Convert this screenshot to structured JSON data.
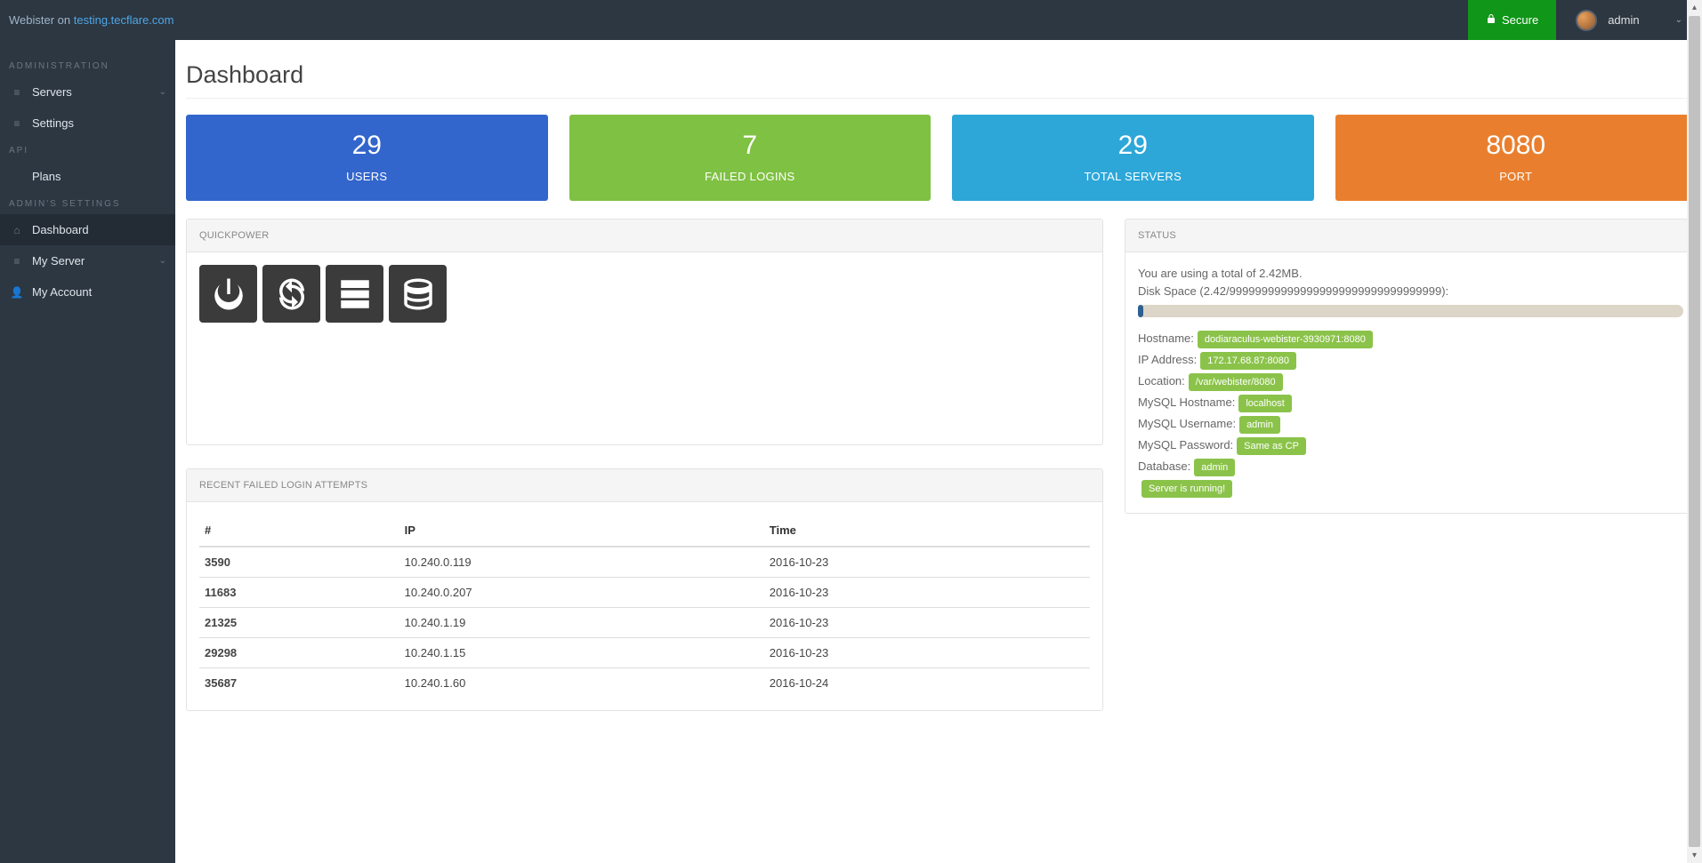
{
  "brand": {
    "prefix": "Webister on ",
    "host": "testing.tecflare.com"
  },
  "topbar": {
    "secure": "Secure",
    "user": "admin"
  },
  "sidebar": {
    "sections": [
      {
        "title": "ADMINISTRATION",
        "items": [
          {
            "label": "Servers",
            "icon": "≡",
            "expandable": true
          },
          {
            "label": "Settings",
            "icon": "≡"
          }
        ]
      },
      {
        "title": "API",
        "items": [
          {
            "label": "Plans",
            "icon": ""
          }
        ]
      },
      {
        "title": "ADMIN'S SETTINGS",
        "items": [
          {
            "label": "Dashboard",
            "icon": "⌂",
            "active": true
          },
          {
            "label": "My Server",
            "icon": "≡",
            "expandable": true
          },
          {
            "label": "My Account",
            "icon": "👤"
          }
        ]
      }
    ]
  },
  "page": {
    "title": "Dashboard"
  },
  "stats": [
    {
      "value": "29",
      "label": "USERS",
      "color": "c-blue"
    },
    {
      "value": "7",
      "label": "FAILED LOGINS",
      "color": "c-green"
    },
    {
      "value": "29",
      "label": "TOTAL SERVERS",
      "color": "c-cyan"
    },
    {
      "value": "8080",
      "label": "PORT",
      "color": "c-orange"
    }
  ],
  "quickpower": {
    "title": "QUICKPOWER"
  },
  "status": {
    "title": "STATUS",
    "usage_prefix": "You are using a total of ",
    "usage_value": "2.42MB",
    "usage_suffix": ".",
    "diskspace": "Disk Space (2.42/999999999999999999999999999999999):",
    "hostname_label": "Hostname:",
    "hostname": "dodiaraculus-webister-3930971:8080",
    "ip_label": "IP Address:",
    "ip": "172.17.68.87:8080",
    "location_label": "Location:",
    "location": "/var/webister/8080",
    "mysqlhost_label": "MySQL Hostname:",
    "mysqlhost": "localhost",
    "mysqluser_label": "MySQL Username:",
    "mysqluser": "admin",
    "mysqlpass_label": "MySQL Password:",
    "mysqlpass": "Same as CP",
    "db_label": "Database:",
    "db": "admin",
    "running": "Server is running!"
  },
  "failed": {
    "title": "RECENT FAILED LOGIN ATTEMPTS",
    "headers": [
      "#",
      "IP",
      "Time"
    ],
    "rows": [
      [
        "3590",
        "10.240.0.119",
        "2016-10-23"
      ],
      [
        "11683",
        "10.240.0.207",
        "2016-10-23"
      ],
      [
        "21325",
        "10.240.1.19",
        "2016-10-23"
      ],
      [
        "29298",
        "10.240.1.15",
        "2016-10-23"
      ],
      [
        "35687",
        "10.240.1.60",
        "2016-10-24"
      ]
    ]
  }
}
